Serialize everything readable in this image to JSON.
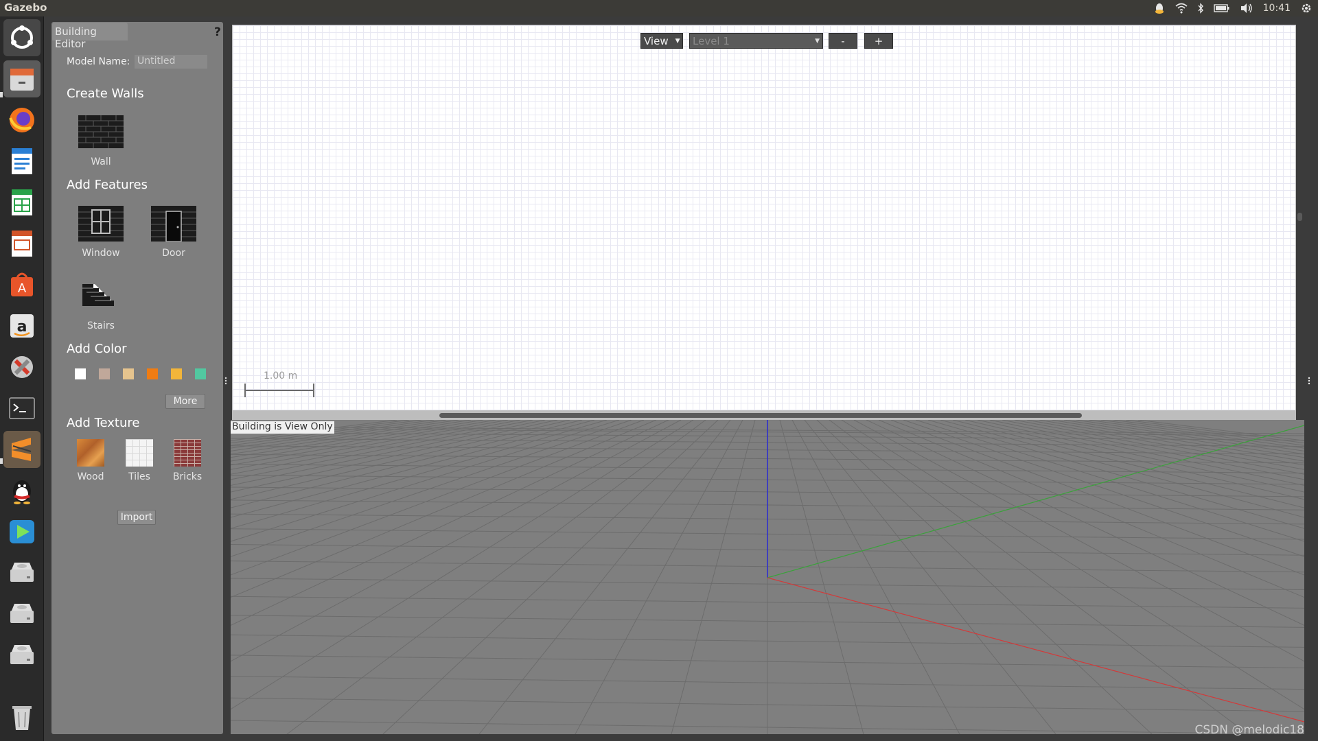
{
  "topbar": {
    "app_title": "Gazebo",
    "clock": "10:41",
    "tray_icons": [
      "qq-tray-icon",
      "wifi-icon",
      "bluetooth-icon",
      "battery-icon",
      "volume-icon",
      "gear-icon"
    ]
  },
  "launcher": {
    "items": [
      "ubuntu-dash",
      "files",
      "firefox",
      "libreoffice-writer",
      "libreoffice-calc",
      "libreoffice-impress",
      "ubuntu-software",
      "amazon",
      "system-settings",
      "terminal",
      "sublime-text",
      "qq",
      "video-player",
      "drive-1",
      "drive-2",
      "drive-3",
      "trash"
    ]
  },
  "panel": {
    "tab_label": "Building Editor",
    "help": "?",
    "model_name_label": "Model Name:",
    "model_name_value": "Untitled",
    "create_walls": "Create Walls",
    "wall": "Wall",
    "add_features": "Add Features",
    "window": "Window",
    "door": "Door",
    "stairs": "Stairs",
    "add_color": "Add Color",
    "colors": [
      "#ffffff",
      "#c0a89a",
      "#e6c48e",
      "#f07c12",
      "#f2b53a",
      "#52c8a0"
    ],
    "more": "More",
    "add_texture": "Add Texture",
    "wood": "Wood",
    "tiles": "Tiles",
    "bricks": "Bricks",
    "import": "Import"
  },
  "editor2d": {
    "view_label": "View",
    "level_value": "Level 1",
    "minus": "-",
    "plus": "+",
    "scale_label": "1.00 m"
  },
  "view3d": {
    "status": "Building is View Only"
  },
  "watermark": "CSDN @melodic18"
}
